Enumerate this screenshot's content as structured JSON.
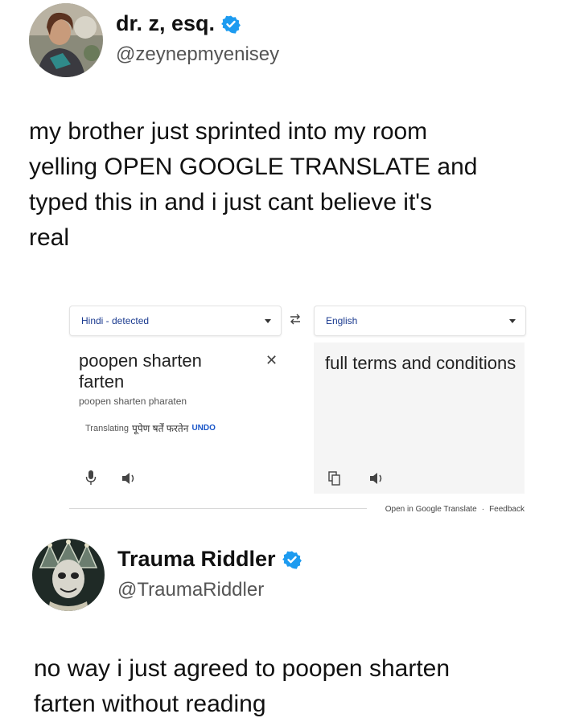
{
  "post1": {
    "display_name": "dr. z, esq.",
    "handle": "@zeynepmyenisey",
    "text": "my brother just sprinted into my room\nyelling OPEN GOOGLE TRANSLATE and\ntyped this in and i just cant believe it's\nreal"
  },
  "translate": {
    "source_lang": "Hindi - detected",
    "target_lang": "English",
    "source_text": "poopen sharten farten",
    "transliteration": "poopen sharten pharaten",
    "translating_label": "Translating",
    "translating_devanagari": "पूपेण षर्तें फरतेन",
    "undo_label": "UNDO",
    "target_text": "full terms and conditions",
    "open_link": "Open in Google Translate",
    "separator": "·",
    "feedback_link": "Feedback"
  },
  "post2": {
    "display_name": "Trauma Riddler",
    "handle": "@TraumaRiddler",
    "text": "no way i just agreed to poopen sharten\nfarten without reading"
  },
  "colors": {
    "verified": "#1d9bf0",
    "link_blue": "#1a56c8"
  }
}
